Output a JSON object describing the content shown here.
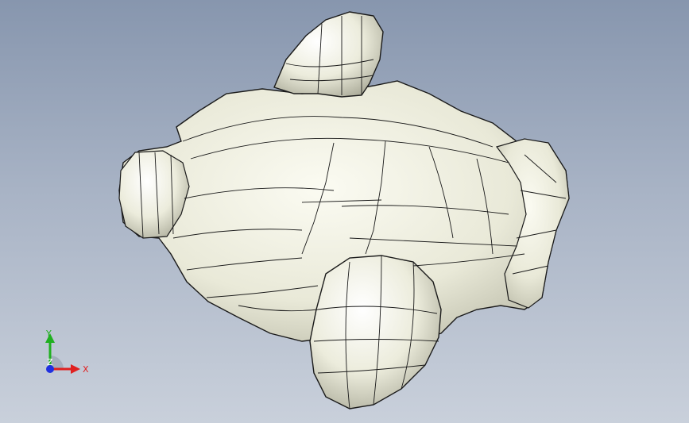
{
  "viewport": {
    "background_top": "#8796ae",
    "background_bottom": "#c9d0db",
    "model_color": "#eeeedd",
    "edge_color": "#1a1a1a"
  },
  "triad": {
    "x_label": "X",
    "y_label": "Y",
    "z_label": "Z",
    "x_color": "#e02020",
    "y_color": "#20b020",
    "z_color": "#2030e0"
  }
}
